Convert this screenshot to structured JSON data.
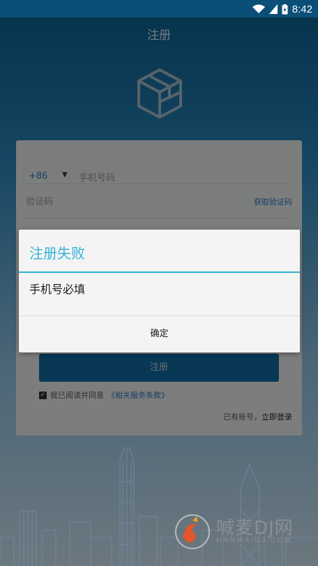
{
  "status_bar": {
    "time": "8:42"
  },
  "header": {
    "title": "注册"
  },
  "form": {
    "country_code": "+86",
    "country_caret": "▼",
    "phone_placeholder": "手机号码",
    "code_placeholder": "验证码",
    "get_code_label": "获取验证码",
    "register_label": "注册",
    "agreement_prefix": "我已阅读并同意",
    "agreement_terms": "《相关服务条款》",
    "have_account": "已有账号，",
    "login_label": "立即登录"
  },
  "dialog": {
    "title": "注册失败",
    "message": "手机号必填",
    "ok_label": "确定"
  },
  "watermark": {
    "text": "喊麦DJ网",
    "sub": "HANMAIDJ.COM"
  }
}
